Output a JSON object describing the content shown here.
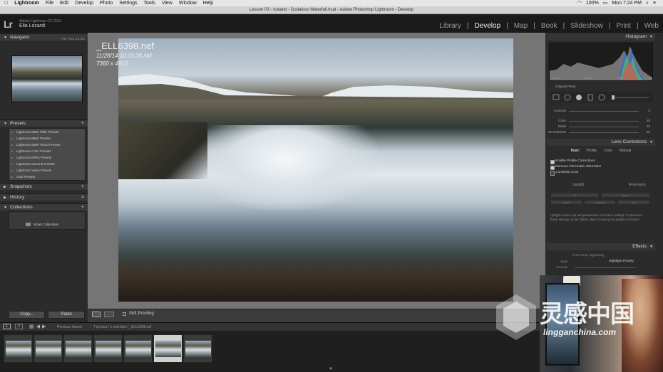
{
  "menubar": {
    "apple": "",
    "app": "Lightroom",
    "items": [
      "File",
      "Edit",
      "Develop",
      "Photo",
      "Settings",
      "Tools",
      "View",
      "Window",
      "Help"
    ],
    "battery": "100%",
    "clock": "Mon 7:24 PM"
  },
  "window_title": "Lesson 03 - Iceland - Godafoss Waterfall.lrcat - Adobe Photoshop Lightroom - Develop",
  "identity": {
    "logo": "Lr",
    "product": "Adobe Lightroom CC 2015",
    "user": "Elia Locardi"
  },
  "modules": [
    {
      "label": "Library",
      "active": false
    },
    {
      "label": "Develop",
      "active": true
    },
    {
      "label": "Map",
      "active": false
    },
    {
      "label": "Book",
      "active": false
    },
    {
      "label": "Slideshow",
      "active": false
    },
    {
      "label": "Print",
      "active": false
    },
    {
      "label": "Web",
      "active": false
    }
  ],
  "left_panel": {
    "navigator": {
      "title": "Navigator",
      "modes": "FIT  FILL  1:1  3:1"
    },
    "presets": {
      "title": "Presets",
      "items": [
        "Lightroom B&W Filter Presets",
        "Lightroom B&W Presets",
        "Lightroom B&W Toned Presets",
        "Lightroom Color Presets",
        "Lightroom Effect Presets",
        "Lightroom General Presets",
        "Lightroom Video Presets",
        "User Presets"
      ]
    },
    "snapshots": {
      "title": "Snapshots"
    },
    "history": {
      "title": "History"
    },
    "collections": {
      "title": "Collections",
      "items": [
        "Smart Collections"
      ]
    },
    "copy_label": "Copy...",
    "paste_label": "Paste"
  },
  "photo_overlay": {
    "filename": "_ELL6398.nef",
    "datetime": "11/28/14 10:33:38 AM",
    "dimensions": "7360 x 4912"
  },
  "toolbar": {
    "soft_proofing": "Soft Proofing"
  },
  "right_panel": {
    "histogram": {
      "title": "Histogram",
      "iso": "ISO 125",
      "focal": "16 mm",
      "aperture": "f / 13",
      "shutter": "30 sec"
    },
    "original_photo": "Original Photo",
    "detail_sliders": [
      {
        "label": "Contrast",
        "value": "0"
      },
      {
        "label": "Color",
        "value": "25"
      },
      {
        "label": "Detail",
        "value": "50"
      },
      {
        "label": "Smoothness",
        "value": "50"
      }
    ],
    "lens_corrections": {
      "title": "Lens Corrections",
      "tabs": [
        {
          "label": "Basic",
          "active": true
        },
        {
          "label": "Profile",
          "active": false
        },
        {
          "label": "Color",
          "active": false
        },
        {
          "label": "Manual",
          "active": false
        }
      ],
      "checks": [
        {
          "label": "Enable Profile Corrections",
          "checked": true
        },
        {
          "label": "Remove Chromatic Aberration",
          "checked": true
        },
        {
          "label": "Constrain Crop",
          "checked": false
        }
      ],
      "upright": "Upright",
      "reanalyze": "Reanalyze",
      "upright_buttons": [
        "Off",
        "Auto",
        "Level",
        "Vertical",
        "Full"
      ],
      "note": "Upright resets crop and perspective correction settings. To preserve these settings, press Option when choosing an Upright correction."
    },
    "effects": {
      "title": "Effects",
      "post_crop": "Post-Crop Vignetting",
      "style_label": "Style",
      "style_value": "Highlight Priority",
      "amount_label": "Amount",
      "amount_value": "0"
    }
  },
  "filmstrip": {
    "page1": "1",
    "page2": "2",
    "source": "Previous Import",
    "count": "7 photos / 1 selected / _ELL6398.nef",
    "selected_index": 5
  },
  "watermark": {
    "chinese": "灵感中国",
    "url": "lingganchina.com"
  },
  "colors": {
    "accent": "#f0f0f0",
    "panel": "#2b2b2b",
    "header": "#393939",
    "background": "#757575"
  }
}
